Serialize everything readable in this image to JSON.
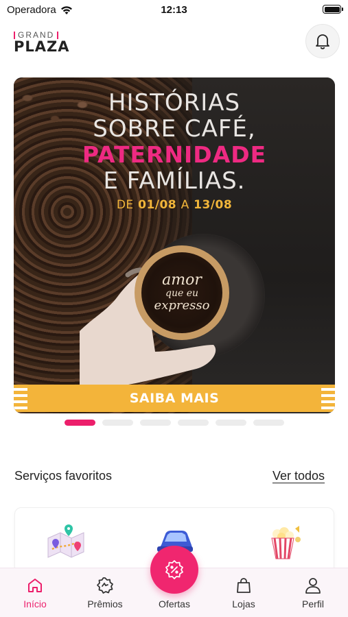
{
  "status_bar": {
    "carrier": "Operadora",
    "time": "12:13"
  },
  "header": {
    "logo_top": "GRAND",
    "logo_bottom": "PLAZA",
    "notifications_icon": "bell-icon"
  },
  "banner": {
    "line1": "HISTÓRIAS",
    "line2": "SOBRE CAFÉ,",
    "line3": "PATERNIDADE",
    "line4": "E FAMÍLIAS.",
    "date_prefix": "DE",
    "date_start": "01/08",
    "date_mid": "A",
    "date_end": "13/08",
    "cup_text_1": "amor",
    "cup_text_2": "que eu",
    "cup_text_3": "expresso",
    "cta_label": "SAIBA MAIS",
    "colors": {
      "accent": "#ee2a82",
      "cta": "#f3b43a"
    }
  },
  "carousel": {
    "total": 6,
    "active_index": 0
  },
  "favorites": {
    "title": "Serviços favoritos",
    "see_all": "Ver todos",
    "items": [
      {
        "icon": "map-icon"
      },
      {
        "icon": "car-icon"
      },
      {
        "icon": "popcorn-icon"
      }
    ]
  },
  "tabbar": {
    "items": [
      {
        "label": "Início",
        "icon": "home-icon",
        "active": true
      },
      {
        "label": "Prêmios",
        "icon": "badge-icon",
        "active": false
      },
      {
        "label": "Ofertas",
        "icon": "discount-icon",
        "active": false
      },
      {
        "label": "Lojas",
        "icon": "shopping-bag-icon",
        "active": false
      },
      {
        "label": "Perfil",
        "icon": "user-icon",
        "active": false
      }
    ],
    "accent": "#ec1f6b"
  }
}
